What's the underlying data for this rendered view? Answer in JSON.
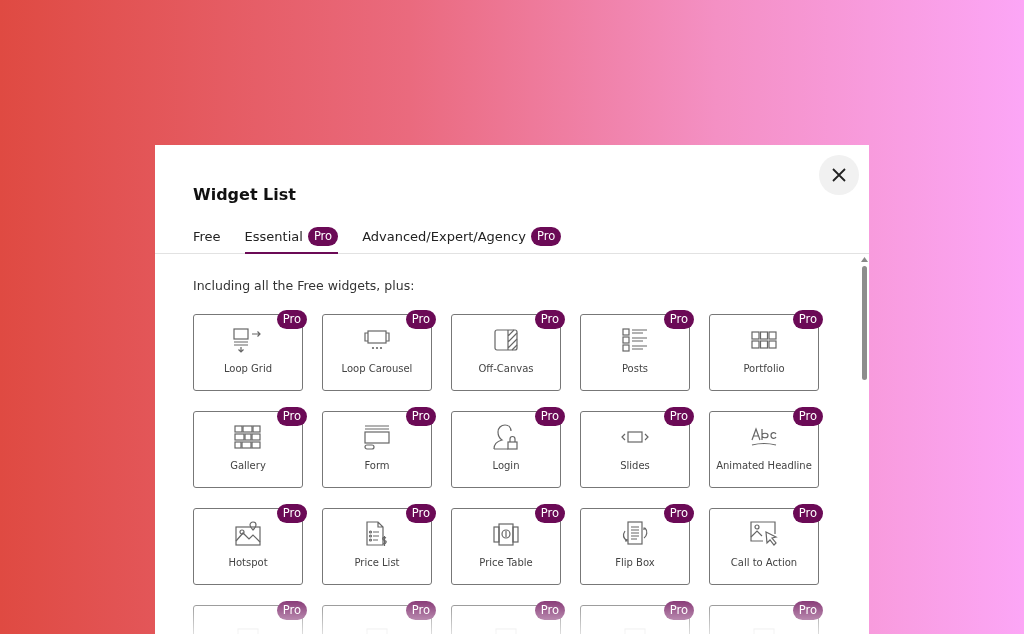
{
  "dialog": {
    "title": "Widget List"
  },
  "tabs": [
    {
      "label": "Free",
      "selected": false
    },
    {
      "label": "Essential",
      "badge": "Pro",
      "selected": true
    },
    {
      "label": "Advanced/Expert/Agency",
      "badge": "Pro",
      "selected": false
    }
  ],
  "intro": "Including all the Free widgets, plus:",
  "widgets": [
    {
      "name": "Loop Grid",
      "badge": "Pro"
    },
    {
      "name": "Loop Carousel",
      "badge": "Pro"
    },
    {
      "name": "Off-Canvas",
      "badge": "Pro"
    },
    {
      "name": "Posts",
      "badge": "Pro"
    },
    {
      "name": "Portfolio",
      "badge": "Pro"
    },
    {
      "name": "Gallery",
      "badge": "Pro"
    },
    {
      "name": "Form",
      "badge": "Pro"
    },
    {
      "name": "Login",
      "badge": "Pro"
    },
    {
      "name": "Slides",
      "badge": "Pro"
    },
    {
      "name": "Animated Headline",
      "badge": "Pro"
    },
    {
      "name": "Hotspot",
      "badge": "Pro"
    },
    {
      "name": "Price List",
      "badge": "Pro"
    },
    {
      "name": "Price Table",
      "badge": "Pro"
    },
    {
      "name": "Flip Box",
      "badge": "Pro"
    },
    {
      "name": "Call to Action",
      "badge": "Pro"
    },
    {
      "badge": "Pro"
    },
    {
      "badge": "Pro"
    },
    {
      "badge": "Pro"
    },
    {
      "badge": "Pro"
    },
    {
      "badge": "Pro"
    }
  ]
}
